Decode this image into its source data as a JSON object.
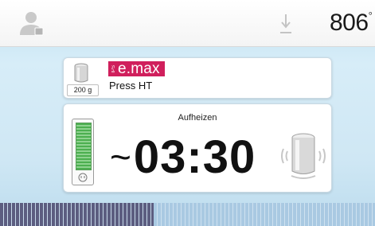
{
  "status_bar": {
    "user_icon": "user-icon",
    "download_icon": "download-arrow-icon",
    "temperature": "806",
    "temperature_unit": "°"
  },
  "material": {
    "icon": "cylinder-icon",
    "weight": "200 g",
    "brand_prefix": "IPS",
    "brand": "e.max",
    "name": "Press HT",
    "brand_color": "#d01f5c"
  },
  "program": {
    "phase": "Aufheizen",
    "countdown_prefix": "~",
    "countdown": "03:30",
    "gauge_icon": "vacuum-gauge-icon",
    "plug_icon": "plug-icon",
    "press_icon": "press-plunger-icon"
  },
  "progress": {
    "fraction": 0.41,
    "done_color": "#5c5d80",
    "todo_color": "#a9c9e2"
  }
}
